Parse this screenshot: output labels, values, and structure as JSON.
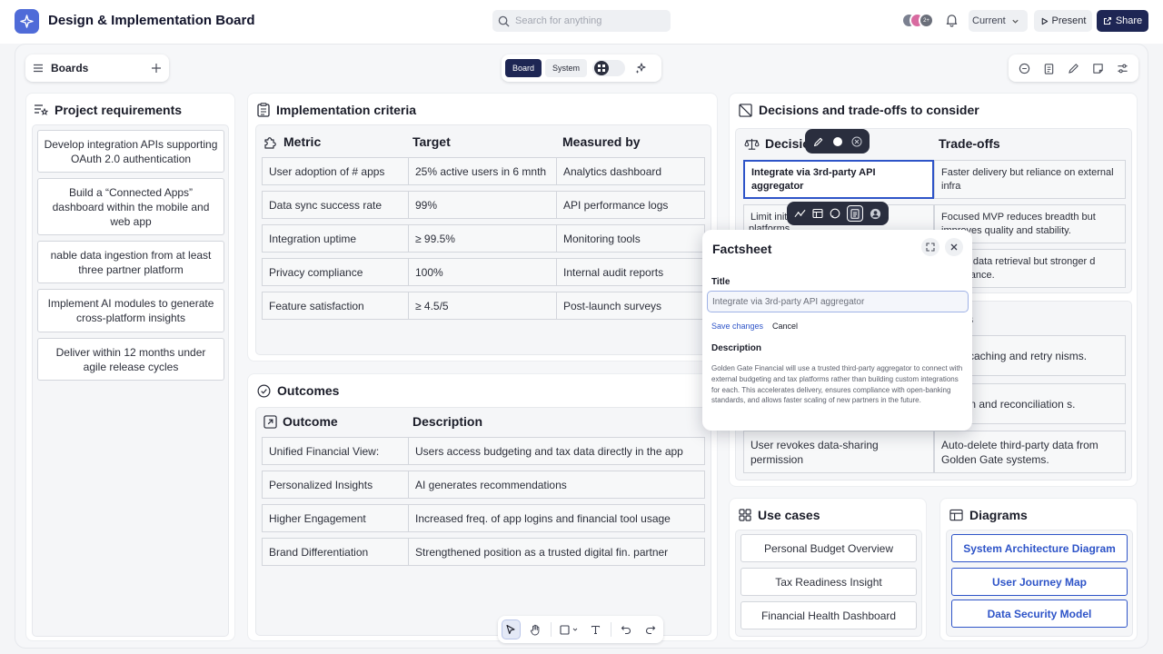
{
  "header": {
    "title": "Design & Implementation Board",
    "search_placeholder": "Search for anything",
    "avatars_extra": "2+",
    "version_select": "Current",
    "present_label": "Present",
    "share_label": "Share"
  },
  "board_toolbar": {
    "boards_label": "Boards",
    "view_tabs": [
      "Board",
      "System"
    ],
    "active_view": "Board"
  },
  "requirements": {
    "title": "Project requirements",
    "items": [
      "Develop integration APIs supporting OAuth 2.0 authentication",
      "Build a “Connected Apps” dashboard within the mobile and web app",
      "nable data ingestion from at least three partner platform",
      "Implement AI modules to generate cross-platform insights",
      "Deliver within 12 months under agile release cycles"
    ]
  },
  "criteria": {
    "title": "Implementation criteria",
    "headers": [
      "Metric",
      "Target",
      "Measured by"
    ],
    "rows": [
      [
        "User adoption of # apps",
        "25% active users in 6 mnth",
        "Analytics dashboard"
      ],
      [
        "Data sync success rate",
        "99%",
        "API performance logs"
      ],
      [
        "Integration uptime",
        "≥ 99.5%",
        "Monitoring tools"
      ],
      [
        "Privacy compliance",
        "100%",
        "Internal audit reports"
      ],
      [
        "Feature satisfaction",
        "≥ 4.5/5",
        "Post-launch surveys"
      ]
    ]
  },
  "outcomes": {
    "title": "Outcomes",
    "headers": [
      "Outcome",
      "Description"
    ],
    "rows": [
      [
        "Unified Financial View:",
        "Users access budgeting and tax data directly in the app"
      ],
      [
        "Personalized Insights",
        "AI generates recommendations"
      ],
      [
        "Higher Engagement",
        "Increased freq. of app logins and financial tool usage"
      ],
      [
        "Brand Differentiation",
        "Strengthened position as a trusted digital fin. partner"
      ]
    ]
  },
  "decisions": {
    "title": "Decisions and trade-offs to consider",
    "headers": [
      "Decisio",
      "Trade-offs"
    ],
    "rows": [
      [
        "Integrate via 3rd-party API aggregator",
        "Faster delivery but reliance on external infra"
      ],
      [
        "Limit initi",
        "Focused MVP reduces breadth but improves quality and stability."
      ],
      [
        "",
        "slower data retrieval but stronger d compliance."
      ]
    ],
    "second_header": "ations",
    "second_rows": [
      [
        "",
        "ment caching and retry nisms."
      ],
      [
        "",
        "lidation and reconciliation s."
      ],
      [
        "User revokes data-sharing permission",
        "Auto-delete third-party data from Golden Gate systems."
      ]
    ],
    "partial_fragments": [
      "r",
      "platforms"
    ]
  },
  "use_cases": {
    "title": "Use cases",
    "items": [
      "Personal Budget Overview",
      "Tax Readiness Insight",
      "Financial Health Dashboard"
    ]
  },
  "diagrams": {
    "title": "Diagrams",
    "items": [
      "System Architecture Diagram",
      "User Journey Map",
      "Data Security Model"
    ]
  },
  "factsheet": {
    "title": "Factsheet",
    "title_label": "Title",
    "title_value": "Integrate via 3rd-party API aggregator",
    "save_label": "Save changes",
    "cancel_label": "Cancel",
    "description_label": "Description",
    "description": "Golden Gate Financial will use a trusted third-party aggregator to connect with external budgeting and tax platforms rather than building custom integrations for each. This accelerates delivery, ensures compliance with open-banking standards, and allows faster scaling of new partners in the future."
  },
  "colors": {
    "accent": "#2e54c8",
    "dark": "#1e2654",
    "brand": "#4f6bd8"
  }
}
